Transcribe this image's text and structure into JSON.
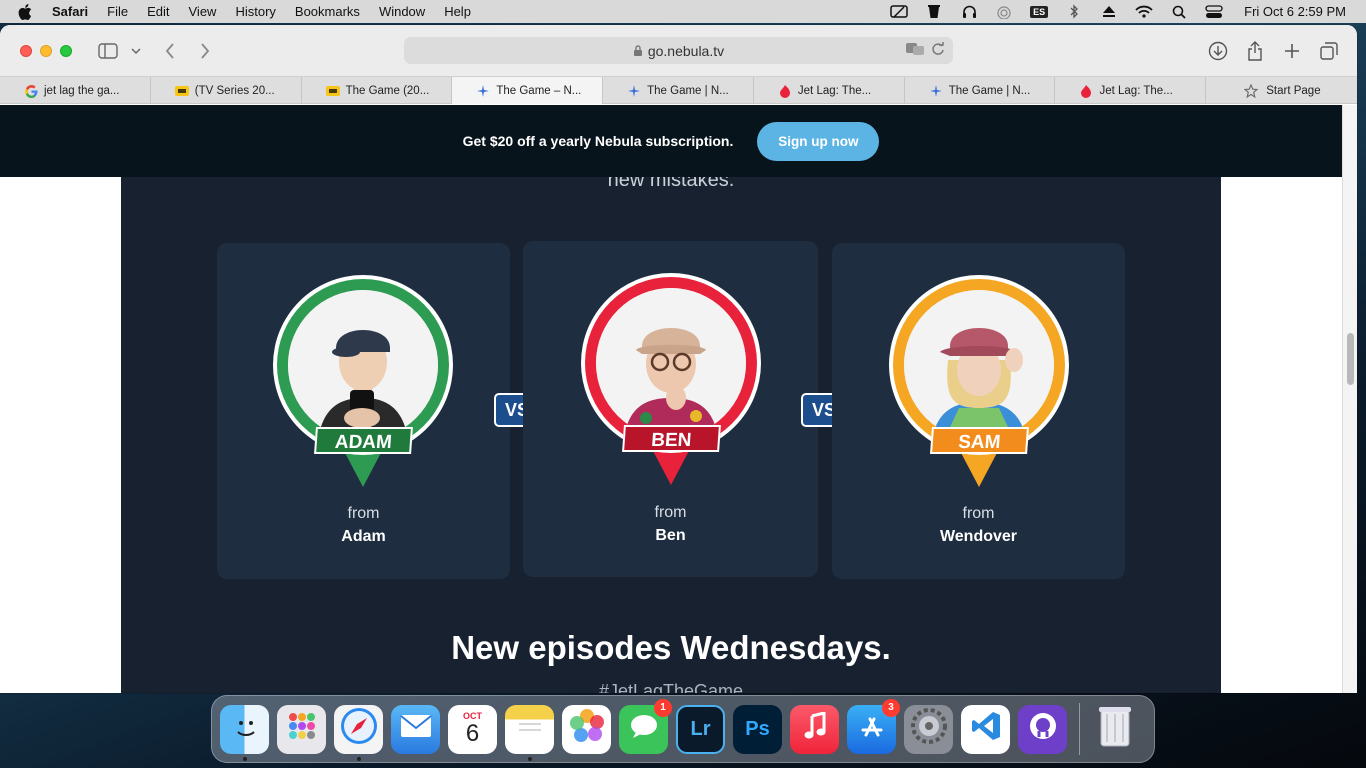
{
  "menubar": {
    "app_name": "Safari",
    "items": [
      "File",
      "Edit",
      "View",
      "History",
      "Bookmarks",
      "Window",
      "Help"
    ],
    "input_source": "ES",
    "clock": "Fri Oct 6  2:59 PM"
  },
  "browser": {
    "url": "go.nebula.tv",
    "tabs": [
      {
        "label": "jet lag the ga...",
        "icon": "google-icon"
      },
      {
        "label": "(TV Series 20...",
        "icon": "imdb-icon"
      },
      {
        "label": "The Game (20...",
        "icon": "imdb-icon"
      },
      {
        "label": "The Game – N...",
        "icon": "nebula-icon",
        "active": true
      },
      {
        "label": "The Game | N...",
        "icon": "nebula-icon"
      },
      {
        "label": "Jet Lag: The...",
        "icon": "flame-icon"
      },
      {
        "label": "The Game | N...",
        "icon": "nebula-icon"
      },
      {
        "label": "Jet Lag: The...",
        "icon": "flame-icon"
      },
      {
        "label": "Start Page",
        "icon": "star-icon"
      }
    ]
  },
  "promo": {
    "text": "Get $20 off a yearly Nebula subscription.",
    "button": "Sign up now"
  },
  "hero": {
    "clipped_text": "new mistakes.",
    "contestants": [
      {
        "tag": "ADAM",
        "from_label": "from",
        "from_name": "Adam",
        "color": "#2e9b52",
        "tag_color": "#1f7a3c"
      },
      {
        "tag": "BEN",
        "from_label": "from",
        "from_name": "Ben",
        "color": "#e8223a",
        "tag_color": "#b8142a"
      },
      {
        "tag": "SAM",
        "from_label": "from",
        "from_name": "Wendover",
        "color": "#f5a623",
        "tag_color": "#f28c1c"
      }
    ],
    "vs_label": "VS",
    "new_episodes": "New episodes Wednesdays.",
    "hashtag": "#JetLagTheGame"
  },
  "dock": {
    "apps": [
      {
        "name": "Finder",
        "running": true
      },
      {
        "name": "Launchpad"
      },
      {
        "name": "Safari",
        "running": true
      },
      {
        "name": "Mail"
      },
      {
        "name": "Calendar",
        "month": "OCT",
        "day": "6"
      },
      {
        "name": "Notes",
        "running": true
      },
      {
        "name": "Photos"
      },
      {
        "name": "Messages",
        "badge": "1"
      },
      {
        "name": "Lightroom",
        "glyph": "Lr"
      },
      {
        "name": "Photoshop",
        "glyph": "Ps"
      },
      {
        "name": "Music"
      },
      {
        "name": "App Store",
        "badge": "3"
      },
      {
        "name": "System Settings"
      },
      {
        "name": "VS Code"
      },
      {
        "name": "GitHub Desktop"
      }
    ],
    "trash": "Trash"
  }
}
